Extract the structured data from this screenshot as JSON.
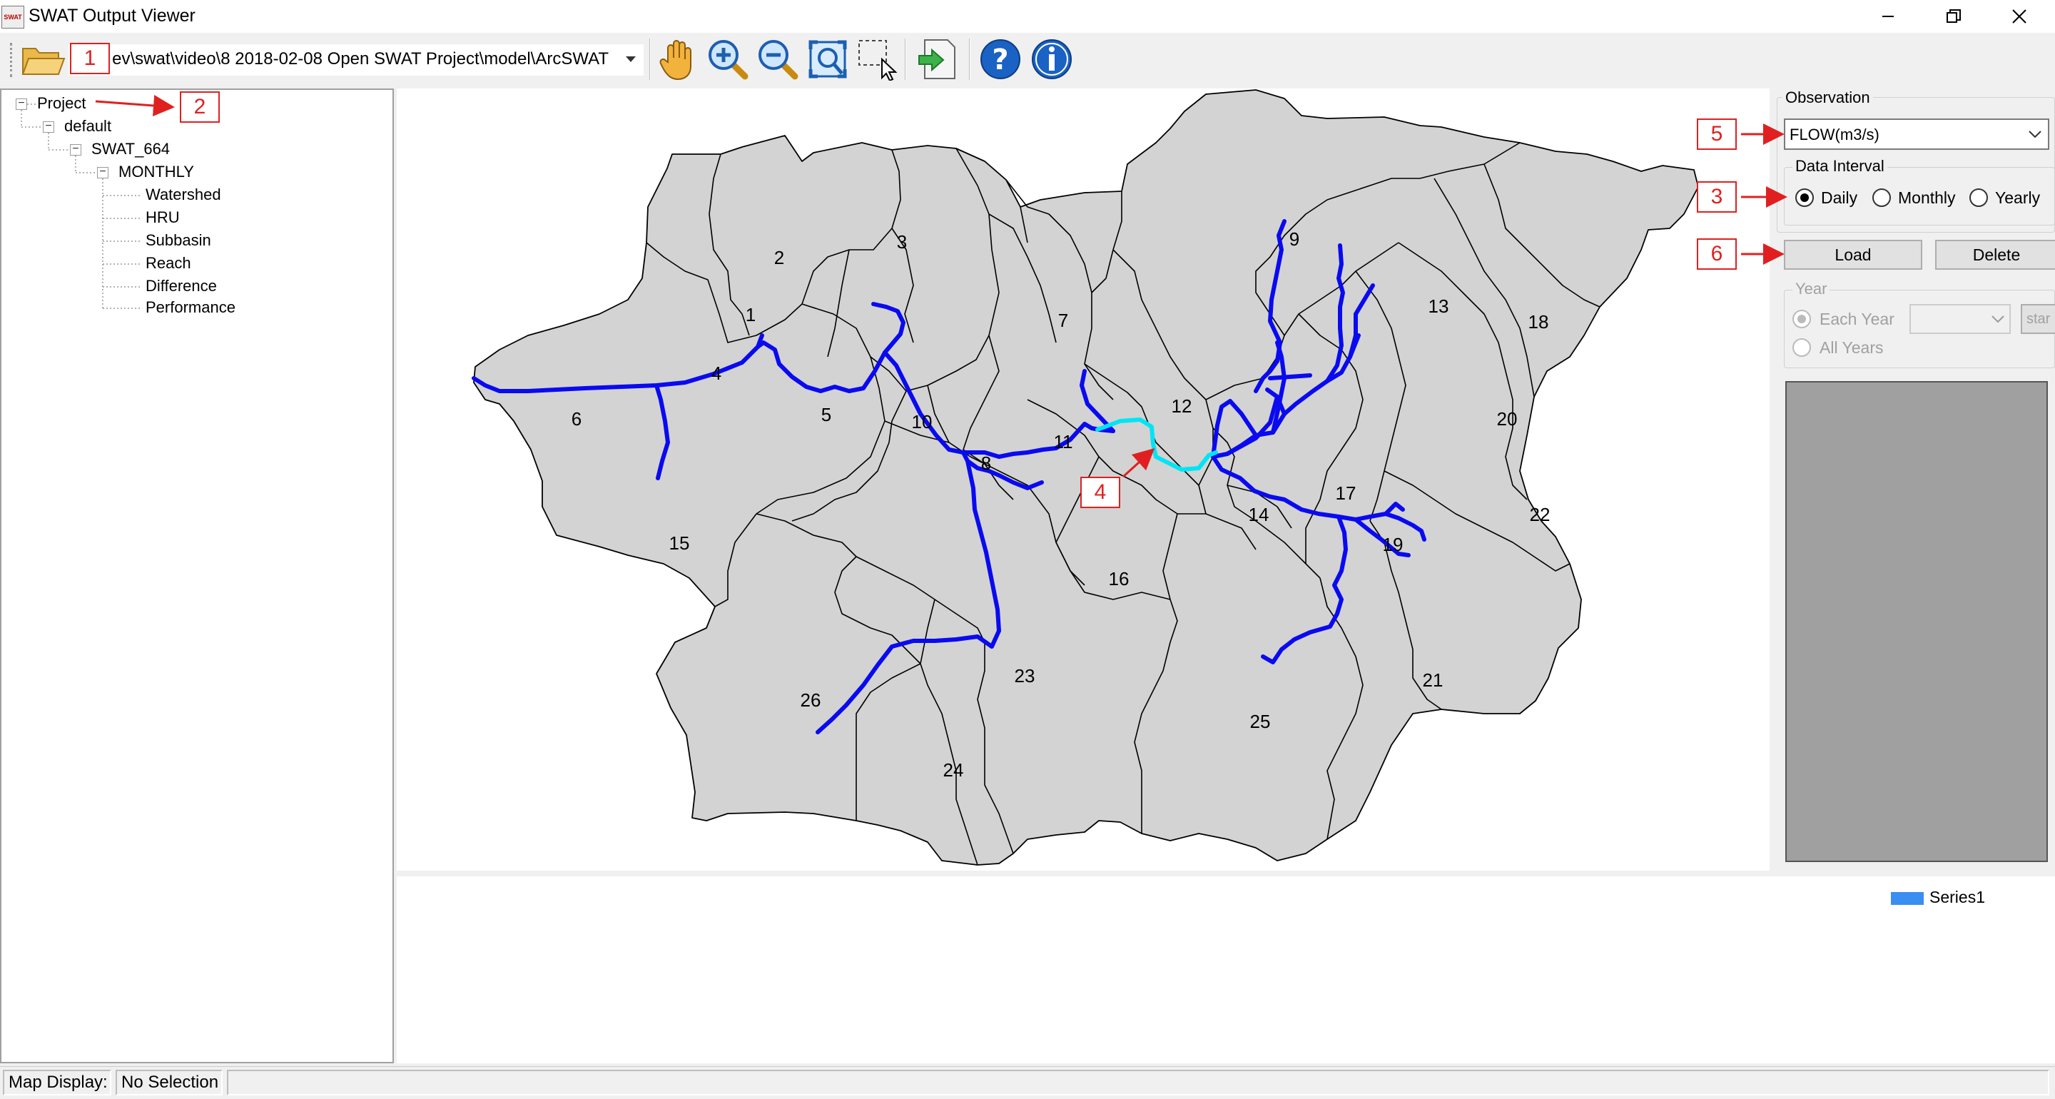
{
  "window": {
    "title": "SWAT Output Viewer",
    "app_icon_text": "SWAT"
  },
  "toolbar": {
    "path_value": "ev\\swat\\video\\8 2018-02-08 Open SWAT Project\\model\\ArcSWAT",
    "tools": [
      "open-folder-icon",
      "pan-hand-icon",
      "zoom-in-icon",
      "zoom-out-icon",
      "full-extent-icon",
      "select-icon",
      "export-icon",
      "help-icon",
      "info-icon"
    ]
  },
  "tree": {
    "root": "Project",
    "scenario": "default",
    "project": "SWAT_664",
    "interval": "MONTHLY",
    "items": [
      "Watershed",
      "HRU",
      "Subbasin",
      "Reach",
      "Difference",
      "Performance"
    ]
  },
  "map": {
    "colors": {
      "subbasin_fill": "#d3d3d3",
      "reach": "#0a0af0",
      "selected_reach": "#00e5f5"
    },
    "subbasins": [
      {
        "id": "1"
      },
      {
        "id": "2"
      },
      {
        "id": "3"
      },
      {
        "id": "4"
      },
      {
        "id": "5"
      },
      {
        "id": "6"
      },
      {
        "id": "7"
      },
      {
        "id": "8"
      },
      {
        "id": "9"
      },
      {
        "id": "10"
      },
      {
        "id": "11"
      },
      {
        "id": "12"
      },
      {
        "id": "13"
      },
      {
        "id": "14"
      },
      {
        "id": "15"
      },
      {
        "id": "16"
      },
      {
        "id": "17"
      },
      {
        "id": "18"
      },
      {
        "id": "19"
      },
      {
        "id": "20"
      },
      {
        "id": "21"
      },
      {
        "id": "22"
      },
      {
        "id": "23"
      },
      {
        "id": "24"
      },
      {
        "id": "25"
      },
      {
        "id": "26"
      }
    ]
  },
  "panel": {
    "observation_title": "Observation",
    "observation_value": "FLOW(m3/s)",
    "interval_title": "Data Interval",
    "intervals": [
      {
        "label": "Daily",
        "selected": true
      },
      {
        "label": "Monthly",
        "selected": false
      },
      {
        "label": "Yearly",
        "selected": false
      }
    ],
    "load_label": "Load",
    "delete_label": "Delete",
    "year_title": "Year",
    "each_year_label": "Each Year",
    "all_years_label": "All Years",
    "start_label": "star"
  },
  "chart": {
    "legend": "Series1"
  },
  "status": {
    "map_display": "Map Display:",
    "selection": "No Selection"
  },
  "callouts": [
    "1",
    "2",
    "3",
    "4",
    "5",
    "6"
  ],
  "accent": {
    "callout_red": "#e02020"
  }
}
